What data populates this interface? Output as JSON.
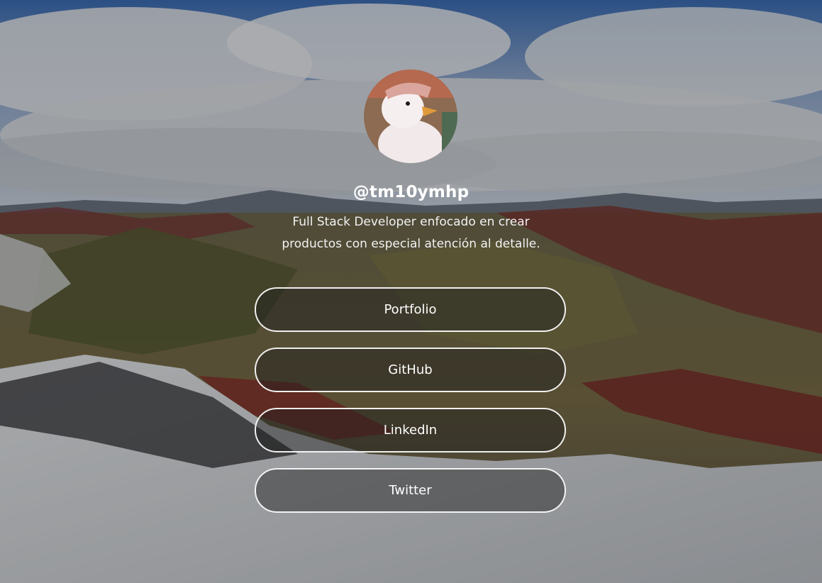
{
  "profile": {
    "username": "@tm10ymhp",
    "bio_line1": "Full Stack Developer enfocado en crear",
    "bio_line2": "productos con especial atención al detalle."
  },
  "links": [
    {
      "label": "Portfolio"
    },
    {
      "label": "GitHub"
    },
    {
      "label": "LinkedIn"
    },
    {
      "label": "Twitter"
    }
  ],
  "colors": {
    "text": "#ffffff",
    "button_border": "#ffffff",
    "overlay": "#000000"
  }
}
